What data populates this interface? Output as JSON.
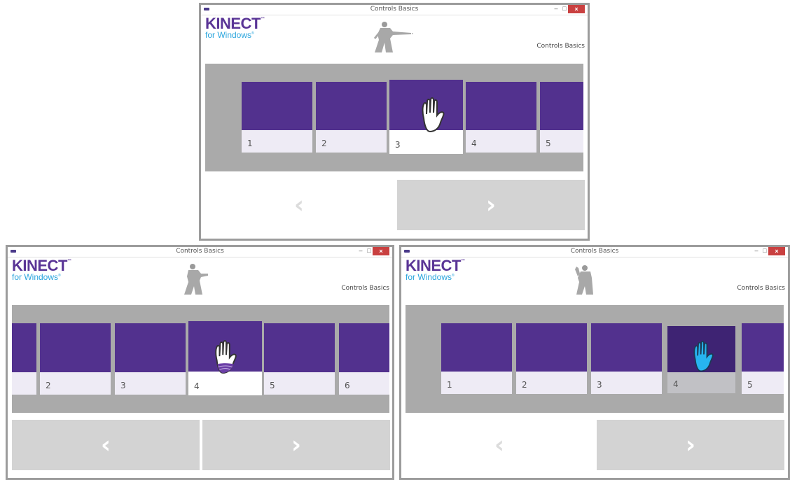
{
  "windows": [
    {
      "title": "Controls Basics",
      "min_glyph": "–",
      "max_glyph": "□",
      "close_glyph": "×",
      "brand": "KINECT",
      "brand_tm": "™",
      "subbrand": "for Windows",
      "subbrand_mark": "®",
      "section": "Controls Basics",
      "tiles": [
        "1",
        "2",
        "3",
        "4",
        "5"
      ],
      "hover_tile": "3",
      "hand_state": "hover",
      "prev": {
        "glyph": "‹",
        "enabled": false,
        "icon": "chevron-left-icon"
      },
      "next": {
        "glyph": "›",
        "enabled": true,
        "icon": "chevron-right-icon"
      }
    },
    {
      "title": "Controls Basics",
      "min_glyph": "–",
      "max_glyph": "□",
      "close_glyph": "×",
      "brand": "KINECT",
      "brand_tm": "™",
      "subbrand": "for Windows",
      "subbrand_mark": "®",
      "section": "Controls Basics",
      "tiles": [
        "2",
        "3",
        "4",
        "5",
        "6"
      ],
      "hover_tile": "4",
      "hand_state": "pressing",
      "prev": {
        "glyph": "‹",
        "enabled": true,
        "icon": "chevron-left-icon"
      },
      "next": {
        "glyph": "›",
        "enabled": true,
        "icon": "chevron-right-icon"
      }
    },
    {
      "title": "Controls Basics",
      "min_glyph": "–",
      "max_glyph": "□",
      "close_glyph": "×",
      "brand": "KINECT",
      "brand_tm": "™",
      "subbrand": "for Windows",
      "subbrand_mark": "®",
      "section": "Controls Basics",
      "tiles": [
        "1",
        "2",
        "3",
        "4",
        "5"
      ],
      "hover_tile": "4",
      "hand_state": "pressed",
      "prev": {
        "glyph": "‹",
        "enabled": false,
        "icon": "chevron-left-icon"
      },
      "next": {
        "glyph": "›",
        "enabled": true,
        "icon": "chevron-right-icon"
      }
    }
  ],
  "colors": {
    "brand_purple": "#5a3596",
    "tile_purple": "#52318e",
    "tile_pressed": "#3e2373",
    "subbrand_blue": "#2aa5dd",
    "strip_gray": "#aaaaaa",
    "button_gray": "#d3d3d3",
    "hand_pressed": "#27b4f0"
  }
}
